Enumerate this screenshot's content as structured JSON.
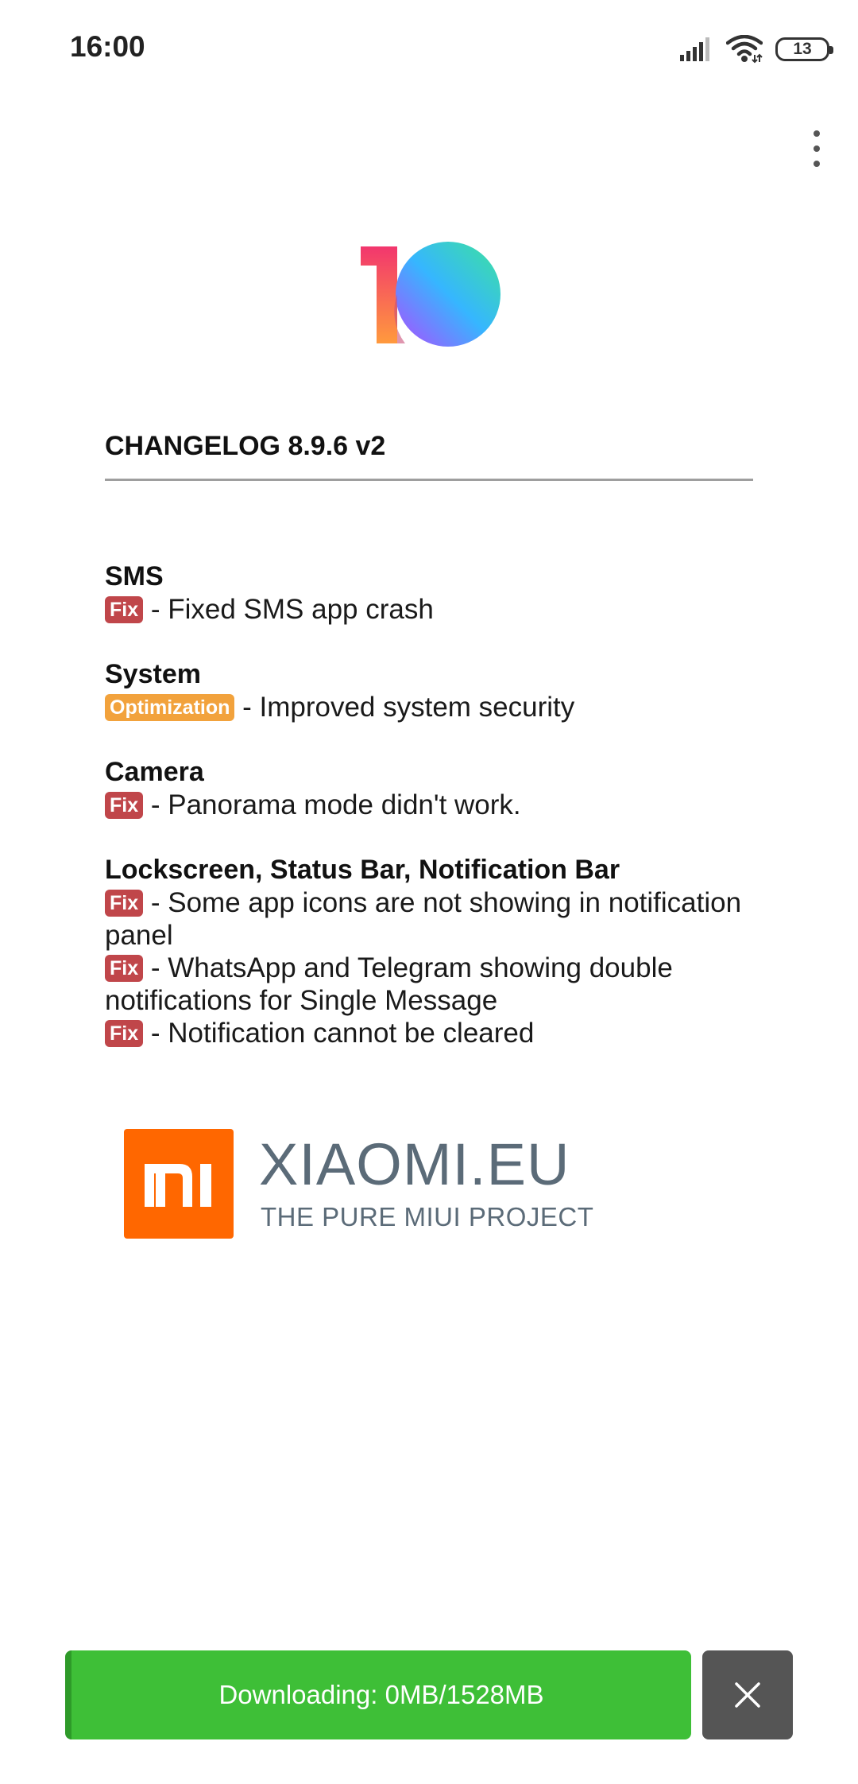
{
  "status_bar": {
    "time": "16:00",
    "battery_level": "13",
    "icons": [
      "signal-icon",
      "wifi-icon",
      "battery-icon"
    ]
  },
  "menu": {
    "icon": "overflow-menu-icon"
  },
  "logo": {
    "icon": "miui-10-logo"
  },
  "changelog": {
    "title": "CHANGELOG 8.9.6 v2",
    "sections": [
      {
        "title": "SMS",
        "entries": [
          {
            "badge": "Fix",
            "text": " - Fixed SMS app crash"
          }
        ]
      },
      {
        "title": "System",
        "entries": [
          {
            "badge": "Optimization",
            "text": " - Improved system security"
          }
        ]
      },
      {
        "title": "Camera",
        "entries": [
          {
            "badge": "Fix",
            "text": " - Panorama mode didn't work."
          }
        ]
      },
      {
        "title": "Lockscreen, Status Bar, Notification Bar",
        "entries": [
          {
            "badge": "Fix",
            "text": " - Some app icons are not showing in notification panel"
          },
          {
            "badge": "Fix",
            "text": " - WhatsApp and Telegram showing double notifications for Single Message"
          },
          {
            "badge": "Fix",
            "text": " - Notification cannot be cleared"
          }
        ]
      }
    ]
  },
  "brand": {
    "name": "XIAOMI.EU",
    "tagline": "THE PURE MIUI PROJECT",
    "mark_text": "mi",
    "mark_color": "#ff6700"
  },
  "download": {
    "label": "Downloading: 0MB/1528MB",
    "progress": 0,
    "color": "#3ebf37"
  },
  "close_button": {
    "icon": "close-icon"
  },
  "colors": {
    "fix_badge": "#c0464a",
    "optimization_badge": "#f2a23c"
  }
}
